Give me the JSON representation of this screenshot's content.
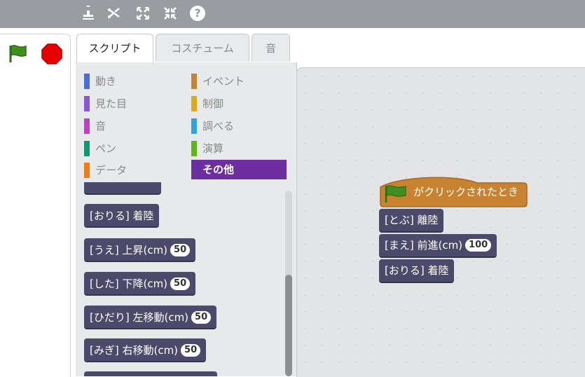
{
  "toolbar": {
    "icons": [
      "duplicate-icon",
      "delete-icon",
      "grow-icon",
      "shrink-icon",
      "help-icon"
    ],
    "help_label": "?"
  },
  "tabs": [
    {
      "label": "スクリプト",
      "active": true
    },
    {
      "label": "コスチューム",
      "active": false
    },
    {
      "label": "音",
      "active": false
    }
  ],
  "categories": [
    {
      "label": "動き",
      "color": "#4a6cd4"
    },
    {
      "label": "見た目",
      "color": "#8a55d7"
    },
    {
      "label": "音",
      "color": "#bb42c3"
    },
    {
      "label": "ペン",
      "color": "#0e9a6c"
    },
    {
      "label": "データ",
      "color": "#ee7d16"
    },
    {
      "label": "イベント",
      "color": "#c88330"
    },
    {
      "label": "制御",
      "color": "#e1a91a"
    },
    {
      "label": "調べる",
      "color": "#2ca5e2"
    },
    {
      "label": "演算",
      "color": "#5cb712"
    },
    {
      "label": "その他",
      "color": "#6d2ea0",
      "active": true
    }
  ],
  "palette_blocks": [
    {
      "text": "[おりる] 着陸",
      "value": null
    },
    {
      "text": "[うえ] 上昇(cm)",
      "value": "50"
    },
    {
      "text": "[した] 下降(cm)",
      "value": "50"
    },
    {
      "text": "[ひだり] 左移動(cm)",
      "value": "50"
    },
    {
      "text": "[みぎ] 右移動(cm)",
      "value": "50"
    }
  ],
  "script": {
    "hat_text": "がクリックされたとき",
    "blocks": [
      {
        "text": "[とぶ] 離陸",
        "value": null
      },
      {
        "text": "[まえ] 前進(cm)",
        "value": "100"
      },
      {
        "text": "[おりる] 着陸",
        "value": null
      }
    ]
  },
  "colors": {
    "topbar": "#999da1",
    "more_blocks": "#4c4a6a",
    "events": "#c88330",
    "flag": "#3f8e1f",
    "stop": "#e60000"
  }
}
